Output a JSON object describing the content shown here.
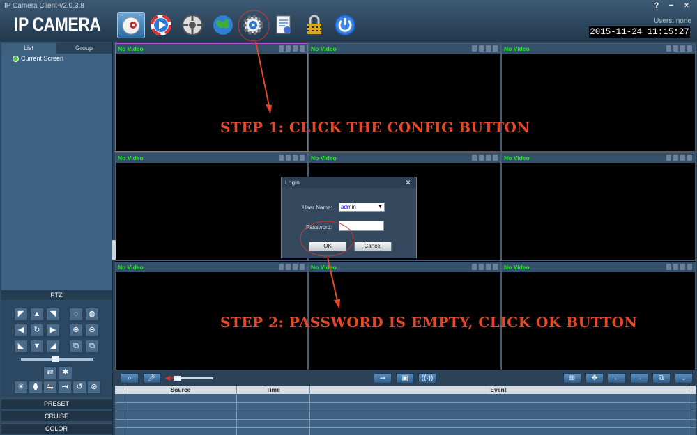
{
  "window": {
    "title": "IP Camera Client-v2.0.3.8",
    "logo": "IP CAMERA",
    "users_label": "Users: none",
    "datetime": "2015-11-24  11:15:27",
    "help": "?",
    "minimize": "−",
    "close": "×"
  },
  "toolbar": {
    "icons": [
      "live-view-icon",
      "playback-icon",
      "ptz-icon",
      "map-icon",
      "config-icon",
      "log-icon",
      "lock-icon",
      "power-icon"
    ]
  },
  "sidebar": {
    "tabs": [
      {
        "label": "List"
      },
      {
        "label": "Group"
      }
    ],
    "tree_item": "Current Screen",
    "ptz_label": "PTZ",
    "bottom": [
      {
        "label": "PRESET"
      },
      {
        "label": "CRUISE"
      },
      {
        "label": "COLOR"
      }
    ]
  },
  "video": {
    "cells": [
      {
        "label": "No Video"
      },
      {
        "label": "No Video"
      },
      {
        "label": "No Video"
      },
      {
        "label": "No Video"
      },
      {
        "label": "No Video"
      },
      {
        "label": "No Video"
      },
      {
        "label": "No Video"
      },
      {
        "label": "No Video"
      },
      {
        "label": "No Video"
      }
    ]
  },
  "annotations": {
    "step1": "STEP 1: CLICK THE CONFIG BUTTON",
    "step2": "STEP 2: PASSWORD IS EMPTY, CLICK OK BUTTON",
    "color": "#e4482b"
  },
  "login": {
    "title": "Login",
    "close": "×",
    "username_label": "User Name:",
    "username_value": "admin",
    "password_label": "Password:",
    "password_value": "",
    "ok_label": "OK",
    "cancel_label": "Cancel"
  },
  "events": {
    "columns": [
      "Source",
      "Time",
      "Event"
    ]
  },
  "colors": {
    "accent": "#20f020",
    "annotation": "#e4482b"
  }
}
